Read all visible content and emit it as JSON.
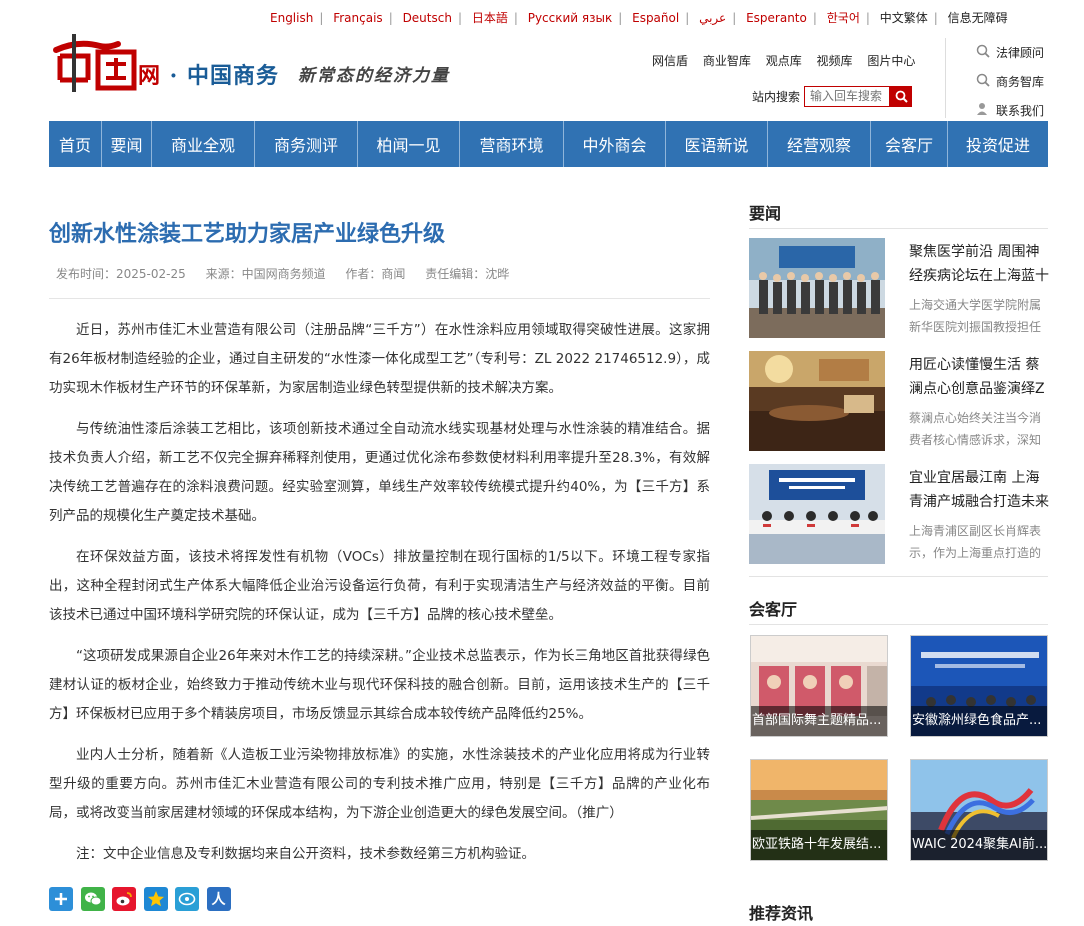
{
  "languages": [
    "English",
    "Français",
    "Deutsch",
    "日本語",
    "Русский язык",
    "Español",
    "عربي",
    "Esperanto",
    "한국어",
    "中文繁体",
    "信息无障碍"
  ],
  "logo": {
    "brand": "网",
    "site": "中国商务",
    "slogan": "新常态的经济力量"
  },
  "top_links": [
    "网信盾",
    "商业智库",
    "观点库",
    "视频库",
    "图片中心"
  ],
  "site_search": {
    "label": "站内搜索",
    "placeholder": "输入回车搜索"
  },
  "right_links": [
    "法律顾问",
    "商务智库",
    "联系我们"
  ],
  "nav": [
    "首页",
    "要闻",
    "商业全观",
    "商务测评",
    "柏闻一见",
    "营商环境",
    "中外商会",
    "医语新说",
    "经营观察",
    "会客厅",
    "投资促进"
  ],
  "article": {
    "title": "创新水性涂装工艺助力家居产业绿色升级",
    "publish_time": "发布时间：2025-02-25",
    "source": "来源：中国网商务频道",
    "author": "作者：商闻",
    "editor": "责任编辑：沈晔",
    "paragraphs": [
      "近日，苏州市佳汇木业营造有限公司（注册品牌“三千方”）在水性涂料应用领域取得突破性进展。这家拥有26年板材制造经验的企业，通过自主研发的“水性漆一体化成型工艺”（专利号：ZL 2022 21746512.9），成功实现木作板材生产环节的环保革新，为家居制造业绿色转型提供新的技术解决方案。",
      "与传统油性漆后涂装工艺相比，该项创新技术通过全自动流水线实现基材处理与水性涂装的精准结合。据技术负责人介绍，新工艺不仅完全摒弃稀释剂使用，更通过优化涂布参数使材料利用率提升至28.3%，有效解决传统工艺普遍存在的涂料浪费问题。经实验室测算，单线生产效率较传统模式提升约40%，为【三千方】系列产品的规模化生产奠定技术基础。",
      "在环保效益方面，该技术将挥发性有机物（VOCs）排放量控制在现行国标的1/5以下。环境工程专家指出，这种全程封闭式生产体系大幅降低企业治污设备运行负荷，有利于实现清洁生产与经济效益的平衡。目前该技术已通过中国环境科学研究院的环保认证，成为【三千方】品牌的核心技术壁垒。",
      "“这项研发成果源自企业26年来对木作工艺的持续深耕。”企业技术总监表示，作为长三角地区首批获得绿色建材认证的板材企业，始终致力于推动传统木业与现代环保科技的融合创新。目前，运用该技术生产的【三千方】环保板材已应用于多个精装房项目，市场反馈显示其综合成本较传统产品降低约25%。",
      "业内人士分析，随着新《人造板工业污染物排放标准》的实施，水性涂装技术的产业化应用将成为行业转型升级的重要方向。苏州市佳汇木业营造有限公司的专利技术推广应用，特别是【三千方】品牌的产业化布局，或将改变当前家居建材领域的环保成本结构，为下游企业创造更大的绿色发展空间。（推广）",
      "注：文中企业信息及专利数据均来自公开资料，技术参数经第三方机构验证。"
    ]
  },
  "share": [
    "人"
  ],
  "sidebar": {
    "news_title": "要闻",
    "news": [
      {
        "headline": "聚焦医学前沿 周围神经疾病论坛在上海蓝十",
        "summary": "上海交通大学医学院附属新华医院刘振国教授担任"
      },
      {
        "headline": "用匠心读懂慢生活 蔡澜点心创意品鉴演绎Z",
        "summary": "蔡澜点心始终关注当今消费者核心情感诉求，深知"
      },
      {
        "headline": "宜业宜居最江南 上海青浦产城融合打造未来",
        "summary": "上海青浦区副区长肖辉表示，作为上海重点打造的"
      }
    ],
    "lounge_title": "会客厅",
    "lounge": [
      "首部国际舞主题精品...",
      "安徽滁州绿色食品产...",
      "欧亚铁路十年发展结...",
      "WAIC 2024聚集AI前..."
    ],
    "recommend_title": "推荐资讯"
  },
  "colors": {
    "brand_red": "#c00000",
    "nav_blue": "#3072b3",
    "title_blue": "#2c6cb0"
  }
}
